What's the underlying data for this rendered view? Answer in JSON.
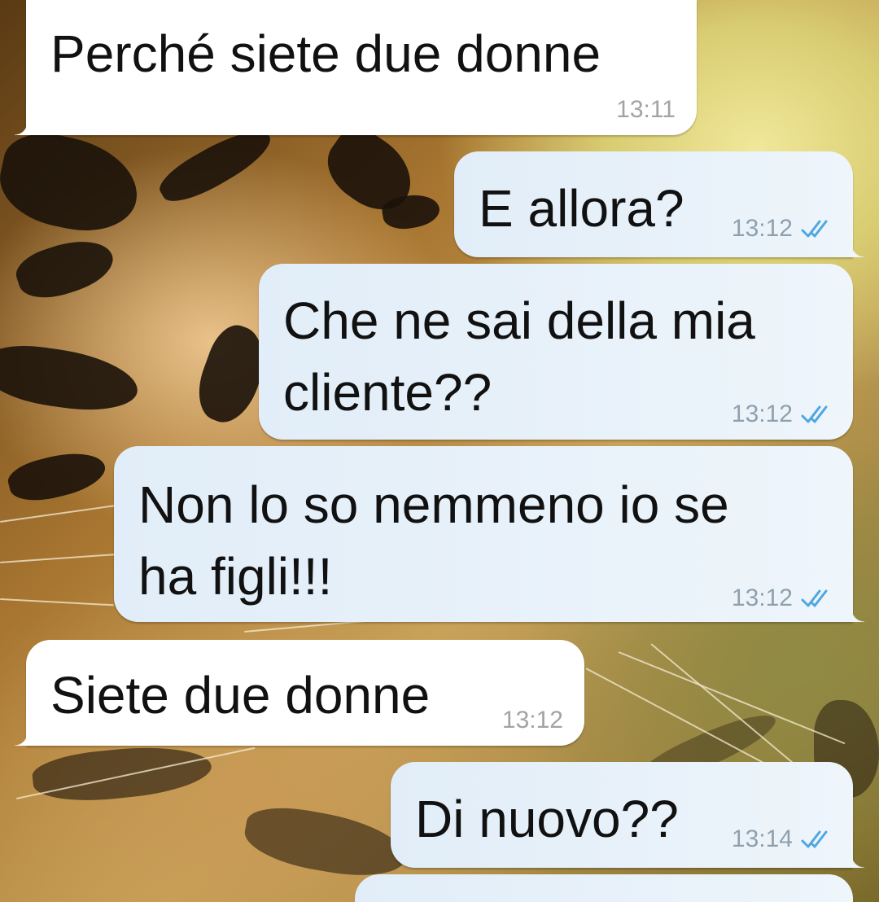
{
  "conversation": {
    "messages": [
      {
        "direction": "incoming",
        "text_lines": [
          "Perché siete due donne"
        ],
        "time": "13:11"
      },
      {
        "direction": "outgoing",
        "text_lines": [
          "E allora?"
        ],
        "time": "13:12",
        "status": "read"
      },
      {
        "direction": "outgoing",
        "text_lines": [
          "Che ne sai della mia",
          "cliente??"
        ],
        "time": "13:12",
        "status": "read"
      },
      {
        "direction": "outgoing",
        "text_lines": [
          "Non lo so nemmeno io se",
          "ha figli!!!"
        ],
        "time": "13:12",
        "status": "read"
      },
      {
        "direction": "incoming",
        "text_lines": [
          "Siete due donne"
        ],
        "time": "13:12"
      },
      {
        "direction": "outgoing",
        "text_lines": [
          "Di nuovo??"
        ],
        "time": "13:14",
        "status": "read"
      }
    ],
    "read_tick_icon": "double-check-icon",
    "colors": {
      "incoming_bubble": "#ffffff",
      "outgoing_bubble": "#e6f0f9",
      "read_tick": "#4fa7e0",
      "timestamp": "#8fa0ad"
    }
  },
  "wallpaper": {
    "icon": "tiger-wallpaper"
  }
}
